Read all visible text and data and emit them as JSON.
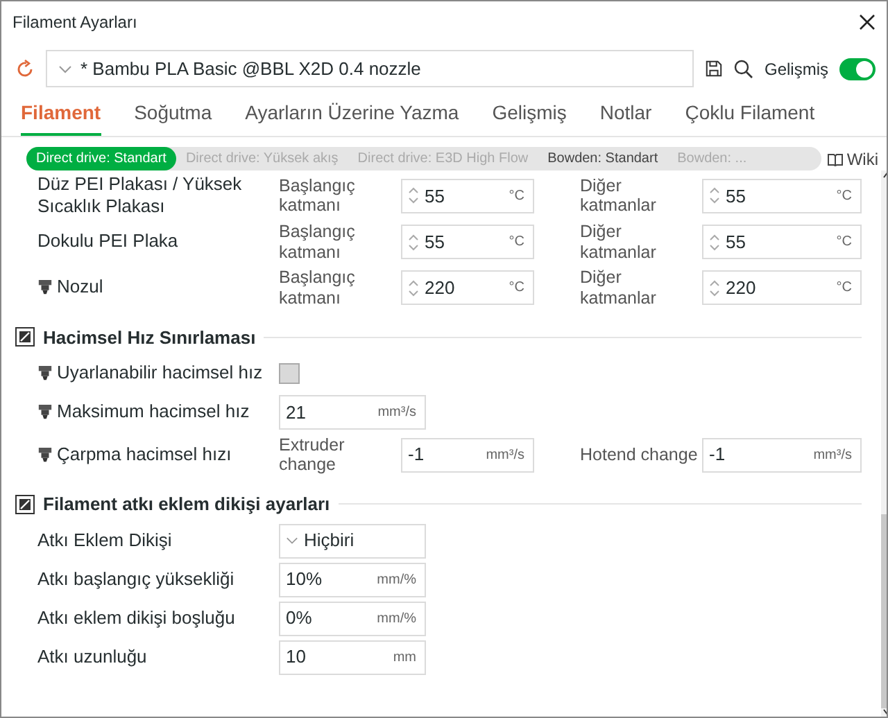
{
  "window": {
    "title": "Filament Ayarları"
  },
  "toolbar": {
    "preset": "* Bambu PLA Basic @BBL X2D 0.4 nozzle",
    "advanced": {
      "label": "Gelişmiş",
      "on": true
    }
  },
  "tabs": [
    {
      "label": "Filament",
      "selected": true
    },
    {
      "label": "Soğutma",
      "selected": false
    },
    {
      "label": "Ayarların Üzerine Yazma",
      "selected": false
    },
    {
      "label": "Gelişmiş",
      "selected": false
    },
    {
      "label": "Notlar",
      "selected": false
    },
    {
      "label": "Çoklu Filament",
      "selected": false
    }
  ],
  "variants": [
    {
      "label": "Direct drive: Standart",
      "selected": true
    },
    {
      "label": "Direct drive: Yüksek akış",
      "selected": false,
      "dim": true
    },
    {
      "label": "Direct drive: E3D High Flow",
      "selected": false,
      "dim": true
    },
    {
      "label": "Bowden: Standart",
      "selected": false,
      "dim": false
    },
    {
      "label": "Bowden: ...",
      "selected": false,
      "dim": true
    }
  ],
  "wiki": "Wiki",
  "sections": [
    {
      "rows": [
        {
          "kind": "pair",
          "label": "Düz PEI Plakası / Yüksek Sıcaklık Plakası",
          "icon": false,
          "fields": [
            {
              "label": "Başlangıç katmanı",
              "value": "55",
              "unit": "°C",
              "spin": true
            },
            {
              "label": "Diğer katmanlar",
              "value": "55",
              "unit": "°C",
              "spin": true
            }
          ]
        },
        {
          "kind": "pair",
          "label": "Dokulu PEI Plaka",
          "icon": false,
          "fields": [
            {
              "label": "Başlangıç katmanı",
              "value": "55",
              "unit": "°C",
              "spin": true
            },
            {
              "label": "Diğer katmanlar",
              "value": "55",
              "unit": "°C",
              "spin": true
            }
          ]
        },
        {
          "kind": "pair",
          "label": "Nozul",
          "icon": true,
          "fields": [
            {
              "label": "Başlangıç katmanı",
              "value": "220",
              "unit": "°C",
              "spin": true
            },
            {
              "label": "Diğer katmanlar",
              "value": "220",
              "unit": "°C",
              "spin": true
            }
          ]
        }
      ]
    },
    {
      "title": "Hacimsel Hız Sınırlaması",
      "rows": [
        {
          "kind": "checkbox",
          "label": "Uyarlanabilir hacimsel hız",
          "icon": true,
          "checked": false
        },
        {
          "kind": "single",
          "label": "Maksimum hacimsel hız",
          "icon": true,
          "value": "21",
          "unit": "mm³/s"
        },
        {
          "kind": "pair",
          "label": "Çarpma hacimsel hızı",
          "icon": true,
          "fields": [
            {
              "label": "Extruder change",
              "value": "-1",
              "unit": "mm³/s",
              "spin": false
            },
            {
              "label": "Hotend change",
              "value": "-1",
              "unit": "mm³/s",
              "spin": false
            }
          ]
        }
      ]
    },
    {
      "title": "Filament atkı eklem dikişi ayarları",
      "rows": [
        {
          "kind": "select",
          "label": "Atkı Eklem Dikişi",
          "icon": false,
          "value": "Hiçbiri"
        },
        {
          "kind": "single",
          "label": "Atkı başlangıç yüksekliği",
          "icon": false,
          "value": "10%",
          "unit": "mm/%"
        },
        {
          "kind": "single",
          "label": "Atkı eklem dikişi boşluğu",
          "icon": false,
          "value": "0%",
          "unit": "mm/%"
        },
        {
          "kind": "single",
          "label": "Atkı uzunluğu",
          "icon": false,
          "value": "10",
          "unit": "mm"
        }
      ]
    }
  ]
}
